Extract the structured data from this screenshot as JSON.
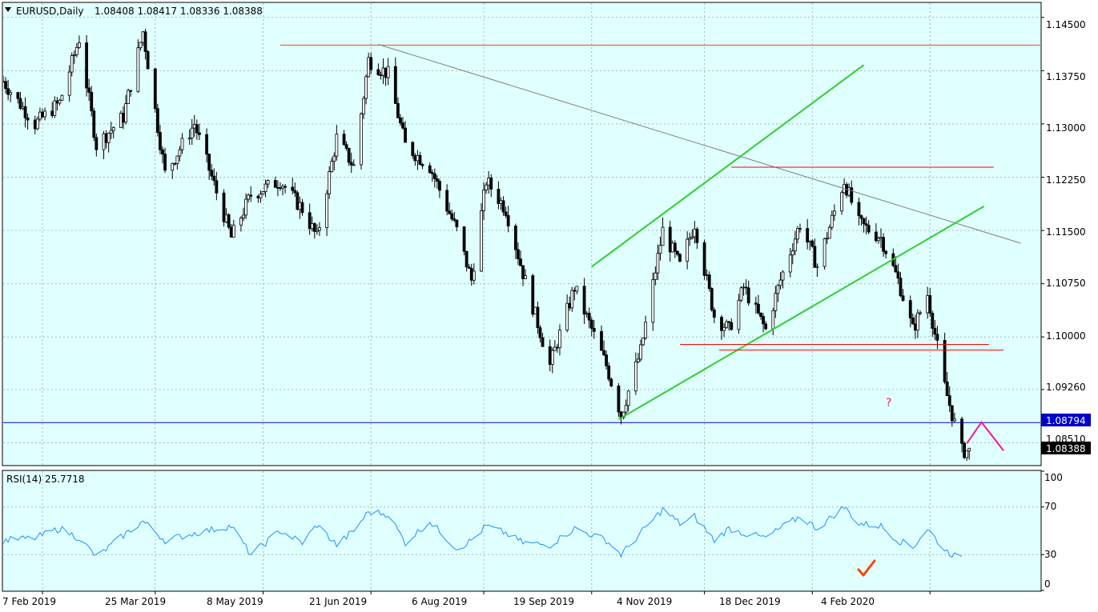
{
  "header": {
    "symbol_timeframe": "EURUSD,Daily",
    "ohlc": "1.08408 1.08417 1.08336 1.08388"
  },
  "price_axis": {
    "ticks": [
      "1.14500",
      "1.13750",
      "1.13000",
      "1.12250",
      "1.11500",
      "1.10750",
      "1.10000",
      "1.09260",
      "1.08510"
    ],
    "hline_label": "1.08794",
    "current_label": "1.08388"
  },
  "time_axis": {
    "labels": [
      "7 Feb 2019",
      "25 Mar 2019",
      "8 May 2019",
      "21 Jun 2019",
      "6 Aug 2019",
      "19 Sep 2019",
      "4 Nov 2019",
      "18 Dec 2019",
      "4 Feb 2020"
    ]
  },
  "rsi": {
    "title": "RSI(14) 25.7718",
    "ticks": [
      "100",
      "70",
      "30",
      "0"
    ]
  },
  "annotations": {
    "question_mark": "?"
  },
  "colors": {
    "background": "#e0ffff",
    "candle": "#000000",
    "rsi_line": "#1e90ff",
    "channel": "#32cd32",
    "support_resistance": "#ff0000",
    "trendline": "#808080",
    "hline": "#0000cd",
    "projection": "#ff1493",
    "checkmark": "#ff4500"
  },
  "chart_data": {
    "type": "candlestick",
    "title": "EURUSD,Daily",
    "ylim": [
      1.082,
      1.147
    ],
    "x_range": [
      "2019-01-22",
      "2020-03-20"
    ],
    "path_points": [
      [
        "2019-01-22",
        1.136
      ],
      [
        "2019-02-04",
        1.13
      ],
      [
        "2019-02-14",
        1.133
      ],
      [
        "2019-02-22",
        1.142
      ],
      [
        "2019-03-01",
        1.127
      ],
      [
        "2019-03-12",
        1.131
      ],
      [
        "2019-03-20",
        1.143
      ],
      [
        "2019-03-29",
        1.123
      ],
      [
        "2019-04-10",
        1.13
      ],
      [
        "2019-04-25",
        1.114
      ],
      [
        "2019-05-03",
        1.12
      ],
      [
        "2019-05-15",
        1.122
      ],
      [
        "2019-05-24",
        1.118
      ],
      [
        "2019-05-30",
        1.114
      ],
      [
        "2019-06-07",
        1.128
      ],
      [
        "2019-06-14",
        1.124
      ],
      [
        "2019-06-20",
        1.139
      ],
      [
        "2019-06-28",
        1.137
      ],
      [
        "2019-07-05",
        1.127
      ],
      [
        "2019-07-15",
        1.124
      ],
      [
        "2019-07-26",
        1.115
      ],
      [
        "2019-08-01",
        1.108
      ],
      [
        "2019-08-07",
        1.122
      ],
      [
        "2019-08-15",
        1.118
      ],
      [
        "2019-08-22",
        1.109
      ],
      [
        "2019-09-02",
        1.096
      ],
      [
        "2019-09-12",
        1.107
      ],
      [
        "2019-09-25",
        1.096
      ],
      [
        "2019-10-01",
        1.089
      ],
      [
        "2019-10-09",
        1.098
      ],
      [
        "2019-10-18",
        1.115
      ],
      [
        "2019-10-25",
        1.11
      ],
      [
        "2019-10-31",
        1.116
      ],
      [
        "2019-11-08",
        1.103
      ],
      [
        "2019-11-14",
        1.101
      ],
      [
        "2019-11-20",
        1.107
      ],
      [
        "2019-11-29",
        1.101
      ],
      [
        "2019-12-05",
        1.108
      ],
      [
        "2019-12-13",
        1.116
      ],
      [
        "2019-12-20",
        1.11
      ],
      [
        "2019-12-31",
        1.122
      ],
      [
        "2020-01-06",
        1.116
      ],
      [
        "2020-01-15",
        1.114
      ],
      [
        "2020-01-22",
        1.108
      ],
      [
        "2020-01-28",
        1.101
      ],
      [
        "2020-02-03",
        1.106
      ],
      [
        "2020-02-10",
        1.093
      ],
      [
        "2020-02-17",
        1.084
      ],
      [
        "2020-02-20",
        1.0839
      ]
    ],
    "rsi_ylim": [
      0,
      100
    ],
    "rsi_path_points": [
      [
        "2019-01-22",
        42
      ],
      [
        "2019-02-04",
        44
      ],
      [
        "2019-02-14",
        52
      ],
      [
        "2019-02-22",
        44
      ],
      [
        "2019-03-01",
        28
      ],
      [
        "2019-03-12",
        46
      ],
      [
        "2019-03-20",
        58
      ],
      [
        "2019-03-29",
        42
      ],
      [
        "2019-04-10",
        48
      ],
      [
        "2019-04-25",
        54
      ],
      [
        "2019-05-03",
        30
      ],
      [
        "2019-05-15",
        50
      ],
      [
        "2019-05-24",
        40
      ],
      [
        "2019-05-30",
        55
      ],
      [
        "2019-06-07",
        38
      ],
      [
        "2019-06-14",
        50
      ],
      [
        "2019-06-20",
        66
      ],
      [
        "2019-06-28",
        64
      ],
      [
        "2019-07-05",
        40
      ],
      [
        "2019-07-15",
        58
      ],
      [
        "2019-07-26",
        35
      ],
      [
        "2019-08-01",
        42
      ],
      [
        "2019-08-07",
        54
      ],
      [
        "2019-08-15",
        48
      ],
      [
        "2019-08-22",
        40
      ],
      [
        "2019-09-02",
        38
      ],
      [
        "2019-09-12",
        52
      ],
      [
        "2019-09-25",
        42
      ],
      [
        "2019-10-01",
        30
      ],
      [
        "2019-10-09",
        48
      ],
      [
        "2019-10-18",
        68
      ],
      [
        "2019-10-25",
        56
      ],
      [
        "2019-10-31",
        62
      ],
      [
        "2019-11-08",
        42
      ],
      [
        "2019-11-14",
        52
      ],
      [
        "2019-11-20",
        48
      ],
      [
        "2019-11-29",
        44
      ],
      [
        "2019-12-05",
        52
      ],
      [
        "2019-12-13",
        62
      ],
      [
        "2019-12-20",
        52
      ],
      [
        "2019-12-31",
        70
      ],
      [
        "2020-01-06",
        56
      ],
      [
        "2020-01-15",
        54
      ],
      [
        "2020-01-22",
        42
      ],
      [
        "2020-01-28",
        36
      ],
      [
        "2020-02-03",
        52
      ],
      [
        "2020-02-10",
        34
      ],
      [
        "2020-02-17",
        25.7718
      ]
    ],
    "drawings": [
      {
        "kind": "hline",
        "y": 1.1411,
        "x1": "2019-05-15",
        "x2": "2020-03-20",
        "color": "#ff4500"
      },
      {
        "kind": "trendline",
        "p1": [
          "2019-06-24",
          1.1412
        ],
        "p2": [
          "2020-03-12",
          1.1132
        ],
        "color": "#808080"
      },
      {
        "kind": "channel",
        "p1": [
          "2019-09-19",
          1.1099
        ],
        "p2": [
          "2020-01-08",
          1.1383
        ],
        "color": "#32cd32"
      },
      {
        "kind": "channel",
        "p1": [
          "2019-09-30",
          1.0884
        ],
        "p2": [
          "2020-02-26",
          1.1184
        ],
        "color": "#32cd32"
      },
      {
        "kind": "segment",
        "p1": [
          "2019-11-15",
          1.1239
        ],
        "p2": [
          "2020-03-01",
          1.1239
        ],
        "color": "#ff0000"
      },
      {
        "kind": "segment",
        "p1": [
          "2019-10-25",
          1.09895
        ],
        "p2": [
          "2020-02-28",
          1.09895
        ],
        "color": "#ff0000"
      },
      {
        "kind": "segment",
        "p1": [
          "2019-11-10",
          1.09815
        ],
        "p2": [
          "2020-03-05",
          1.09815
        ],
        "color": "#ff0000"
      },
      {
        "kind": "hline",
        "y": 1.08794,
        "x1": "2019-01-22",
        "x2": "2020-03-20",
        "color": "#0000cd"
      },
      {
        "kind": "projection",
        "points": [
          [
            "2020-02-19",
            1.085
          ],
          [
            "2020-02-25",
            1.088
          ],
          [
            "2020-03-05",
            1.084
          ]
        ],
        "color": "#ff1493"
      }
    ]
  }
}
